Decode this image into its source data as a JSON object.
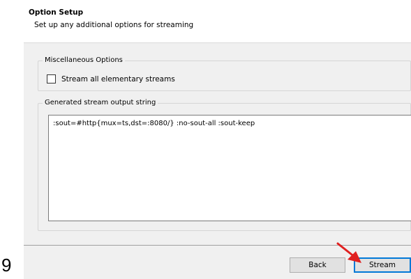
{
  "page_number": "9",
  "header": {
    "title": "Option Setup",
    "subtitle": "Set up any additional options for streaming"
  },
  "misc_options": {
    "label": "Miscellaneous Options",
    "stream_all": {
      "label": "Stream all elementary streams",
      "checked": false
    }
  },
  "output_string": {
    "label": "Generated stream output string",
    "value": ":sout=#http{mux=ts,dst=:8080/} :no-sout-all :sout-keep"
  },
  "buttons": {
    "back": "Back",
    "stream": "Stream"
  },
  "annotation": {
    "arrow_color": "#e02020"
  }
}
